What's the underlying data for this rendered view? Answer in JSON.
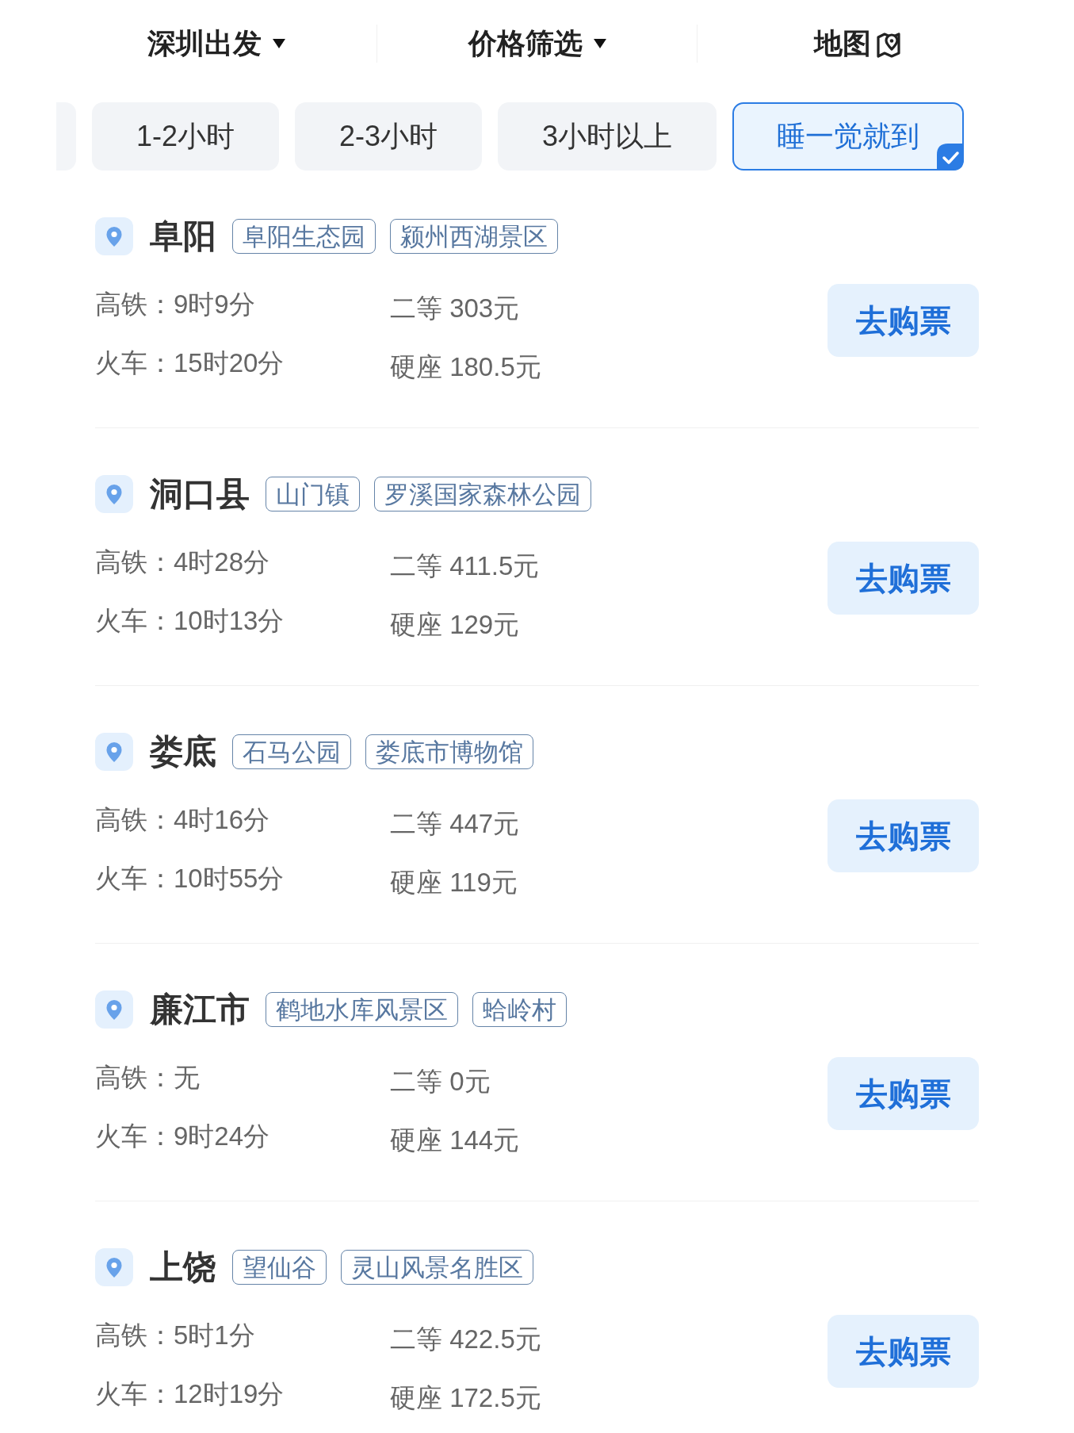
{
  "header": {
    "tabs": [
      {
        "label": "深圳出发",
        "kind": "dropdown"
      },
      {
        "label": "价格筛选",
        "kind": "dropdown"
      },
      {
        "label": "地图",
        "kind": "map"
      }
    ]
  },
  "duration_filters": [
    {
      "label": "1-2小时",
      "selected": false
    },
    {
      "label": "2-3小时",
      "selected": false
    },
    {
      "label": "3小时以上",
      "selected": false
    },
    {
      "label": "睡一觉就到",
      "selected": true
    }
  ],
  "destinations": [
    {
      "city": "阜阳",
      "tags": [
        "阜阳生态园",
        "颍州西湖景区"
      ],
      "times": [
        "高铁：9时9分",
        "火车：15时20分"
      ],
      "prices": [
        "二等 303元",
        "硬座 180.5元"
      ],
      "button": "去购票"
    },
    {
      "city": "洞口县",
      "tags": [
        "山门镇",
        "罗溪国家森林公园"
      ],
      "times": [
        "高铁：4时28分",
        "火车：10时13分"
      ],
      "prices": [
        "二等 411.5元",
        "硬座 129元"
      ],
      "button": "去购票"
    },
    {
      "city": "娄底",
      "tags": [
        "石马公园",
        "娄底市博物馆"
      ],
      "times": [
        "高铁：4时16分",
        "火车：10时55分"
      ],
      "prices": [
        "二等 447元",
        "硬座 119元"
      ],
      "button": "去购票"
    },
    {
      "city": "廉江市",
      "tags": [
        "鹤地水库风景区",
        "蛤岭村"
      ],
      "times": [
        "高铁：无",
        "火车：9时24分"
      ],
      "prices": [
        "二等 0元",
        "硬座 144元"
      ],
      "button": "去购票"
    },
    {
      "city": "上饶",
      "tags": [
        "望仙谷",
        "灵山风景名胜区"
      ],
      "times": [
        "高铁：5时1分",
        "火车：12时19分"
      ],
      "prices": [
        "二等 422.5元",
        "硬座 172.5元"
      ],
      "button": "去购票"
    }
  ]
}
